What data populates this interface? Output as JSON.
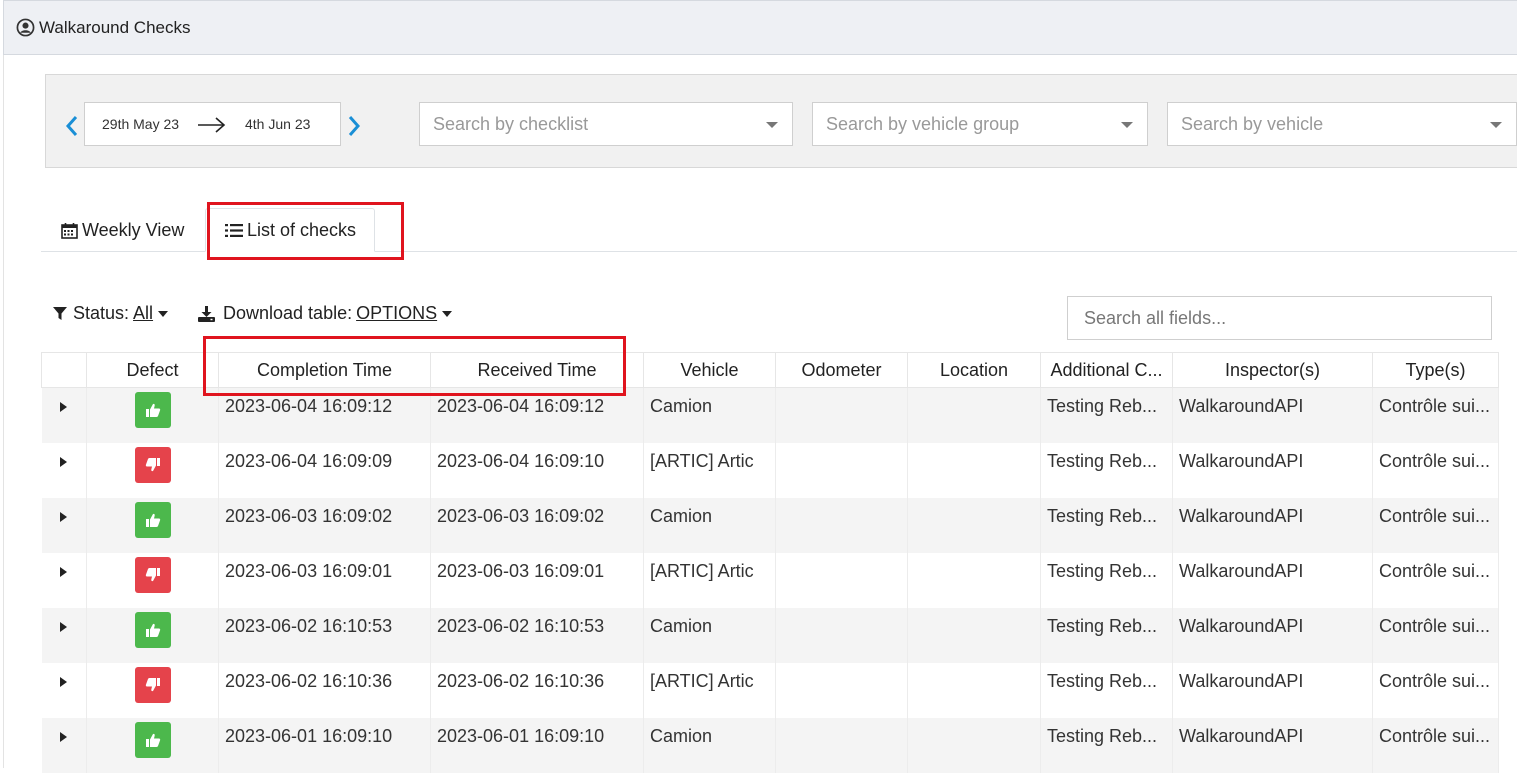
{
  "header": {
    "title": "Walkaround Checks",
    "icon": "user-circle-icon"
  },
  "filters": {
    "date_from": "29th May 23",
    "date_to": "4th Jun 23",
    "checklist_placeholder": "Search by checklist",
    "vehicle_group_placeholder": "Search by vehicle group",
    "vehicle_placeholder": "Search by vehicle"
  },
  "tabs": [
    {
      "label": "Weekly View",
      "icon": "calendar-icon"
    },
    {
      "label": "List of checks",
      "icon": "list-icon"
    }
  ],
  "toolbar": {
    "status_label": "Status:",
    "status_value": "All",
    "download_label": "Download table:",
    "download_value": "OPTIONS",
    "search_placeholder": "Search all fields..."
  },
  "table": {
    "columns": [
      "",
      "Defect",
      "Completion Time",
      "Received Time",
      "Vehicle",
      "Odometer",
      "Location",
      "Additional C...",
      "Inspector(s)",
      "Type(s)"
    ],
    "rows": [
      {
        "defect": "ok",
        "completion": "2023-06-04 16:09:12",
        "received": "2023-06-04 16:09:12",
        "vehicle": "Camion",
        "odometer": "",
        "location": "",
        "additional": "Testing Reb...",
        "inspector": "WalkaroundAPI",
        "type": "Contrôle sui..."
      },
      {
        "defect": "bad",
        "completion": "2023-06-04 16:09:09",
        "received": "2023-06-04 16:09:10",
        "vehicle": "[ARTIC] Artic",
        "odometer": "",
        "location": "",
        "additional": "Testing Reb...",
        "inspector": "WalkaroundAPI",
        "type": "Contrôle sui..."
      },
      {
        "defect": "ok",
        "completion": "2023-06-03 16:09:02",
        "received": "2023-06-03 16:09:02",
        "vehicle": "Camion",
        "odometer": "",
        "location": "",
        "additional": "Testing Reb...",
        "inspector": "WalkaroundAPI",
        "type": "Contrôle sui..."
      },
      {
        "defect": "bad",
        "completion": "2023-06-03 16:09:01",
        "received": "2023-06-03 16:09:01",
        "vehicle": "[ARTIC] Artic",
        "odometer": "",
        "location": "",
        "additional": "Testing Reb...",
        "inspector": "WalkaroundAPI",
        "type": "Contrôle sui..."
      },
      {
        "defect": "ok",
        "completion": "2023-06-02 16:10:53",
        "received": "2023-06-02 16:10:53",
        "vehicle": "Camion",
        "odometer": "",
        "location": "",
        "additional": "Testing Reb...",
        "inspector": "WalkaroundAPI",
        "type": "Contrôle sui..."
      },
      {
        "defect": "bad",
        "completion": "2023-06-02 16:10:36",
        "received": "2023-06-02 16:10:36",
        "vehicle": "[ARTIC] Artic",
        "odometer": "",
        "location": "",
        "additional": "Testing Reb...",
        "inspector": "WalkaroundAPI",
        "type": "Contrôle sui..."
      },
      {
        "defect": "ok",
        "completion": "2023-06-01 16:09:10",
        "received": "2023-06-01 16:09:10",
        "vehicle": "Camion",
        "odometer": "",
        "location": "",
        "additional": "Testing Reb...",
        "inspector": "WalkaroundAPI",
        "type": "Contrôle sui..."
      }
    ]
  },
  "colors": {
    "ok": "#4cb84c",
    "bad": "#e5434b",
    "highlight": "#e0141e",
    "accent_arrow": "#1a8fd6"
  }
}
